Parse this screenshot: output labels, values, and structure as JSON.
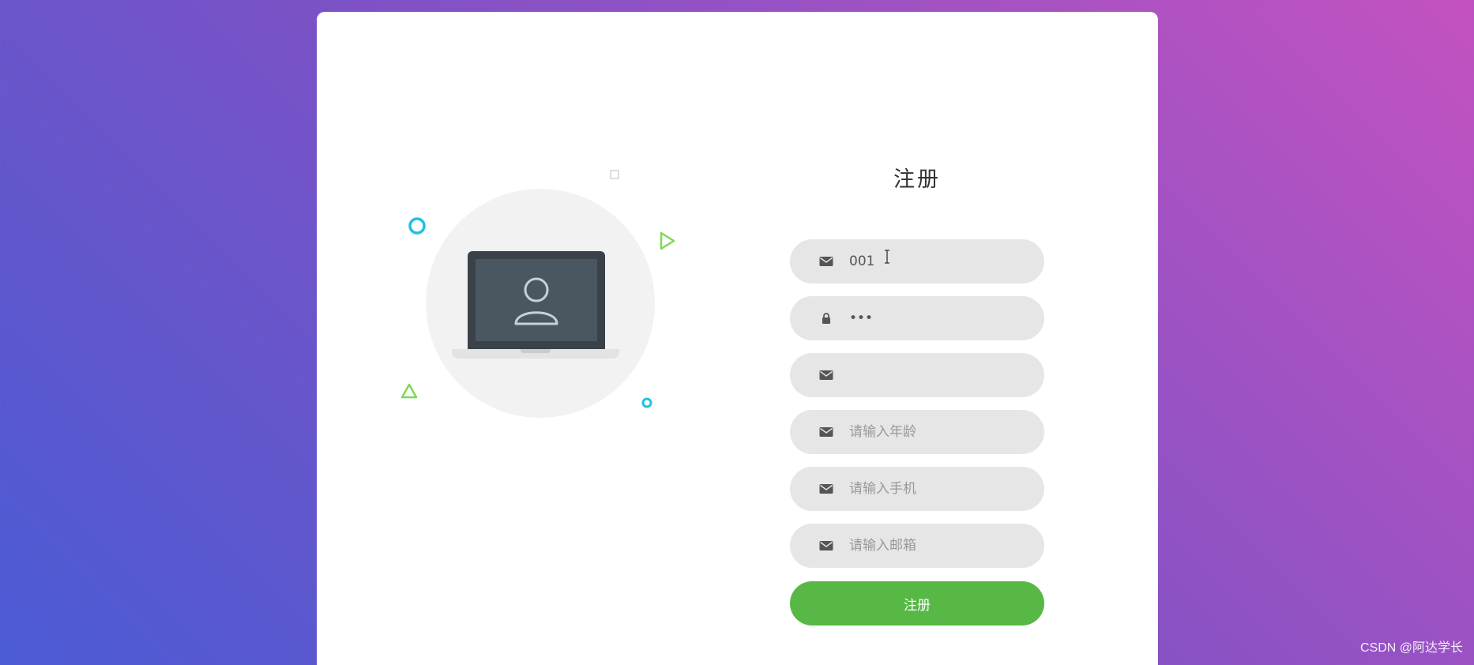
{
  "form": {
    "title": "注册",
    "fields": [
      {
        "icon": "envelope-icon",
        "value": "001",
        "placeholder": ""
      },
      {
        "icon": "lock-icon",
        "value": "•••",
        "placeholder": ""
      },
      {
        "icon": "envelope-icon",
        "value": "",
        "placeholder": ""
      },
      {
        "icon": "envelope-icon",
        "value": "",
        "placeholder": "请输入年龄"
      },
      {
        "icon": "envelope-icon",
        "value": "",
        "placeholder": "请输入手机"
      },
      {
        "icon": "envelope-icon",
        "value": "",
        "placeholder": "请输入邮箱"
      }
    ],
    "submit_label": "注册"
  },
  "watermark": "CSDN @阿达学长",
  "colors": {
    "submit": "#57b846",
    "field_bg": "#e6e6e6",
    "accent_cyan": "#1fc1e4",
    "accent_green": "#7ed957"
  }
}
